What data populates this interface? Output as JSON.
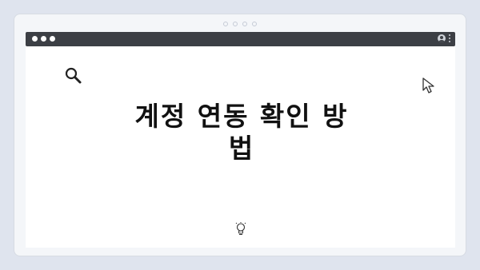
{
  "slide": {
    "pager_dot_count": 4,
    "heading": "계정 연동 확인 방법"
  },
  "window": {
    "traffic_dots": 3
  },
  "icons": {
    "search": "search-icon",
    "cursor": "cursor-icon",
    "user": "user-icon",
    "menu": "kebab-menu-icon",
    "lightbulb": "lightbulb-icon"
  },
  "colors": {
    "page_background": "#dfe4ee",
    "frame_background": "#f4f6f9",
    "titlebar": "#3c3f45",
    "content_background": "#ffffff",
    "text": "#111111"
  }
}
